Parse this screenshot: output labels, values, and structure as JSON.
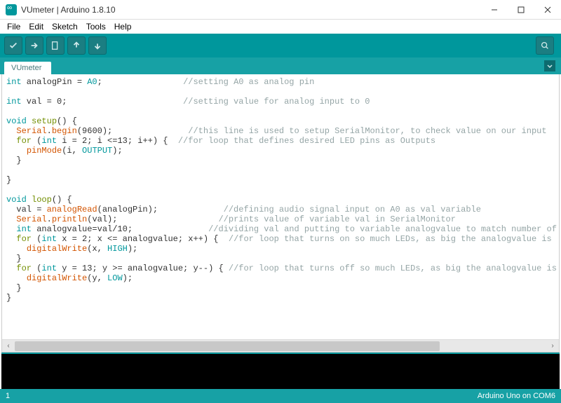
{
  "window": {
    "title": "VUmeter | Arduino 1.8.10"
  },
  "menu": {
    "file": "File",
    "edit": "Edit",
    "sketch": "Sketch",
    "tools": "Tools",
    "help": "Help"
  },
  "tab": {
    "name": "VUmeter"
  },
  "status": {
    "line": "1",
    "board": "Arduino Uno on COM6"
  },
  "code": {
    "l1_a": "int",
    "l1_b": " analogPin = ",
    "l1_c": "A0",
    "l1_d": ";                ",
    "l1_e": "//setting A0 as analog pin",
    "l2": "",
    "l3_a": "int",
    "l3_b": " val = 0;                       ",
    "l3_e": "//setting value for analog input to 0",
    "l4": "",
    "l5_a": "void",
    "l5_b": " ",
    "l5_c": "setup",
    "l5_d": "() {",
    "l6_a": "  ",
    "l6_b": "Serial",
    "l6_c": ".",
    "l6_d": "begin",
    "l6_e": "(9600);               ",
    "l6_f": "//this line is used to setup SerialMonitor, to check value on our input",
    "l7_a": "  ",
    "l7_b": "for",
    "l7_c": " (",
    "l7_d": "int",
    "l7_e": " i = 2; i <=13; i++) {  ",
    "l7_f": "//for loop that defines desired LED pins as Outputs",
    "l8_a": "    ",
    "l8_b": "pinMode",
    "l8_c": "(i, ",
    "l8_d": "OUTPUT",
    "l8_e": ");",
    "l9": "  }",
    "l10": "",
    "l11": "}",
    "l12": "",
    "l13_a": "void",
    "l13_b": " ",
    "l13_c": "loop",
    "l13_d": "() {",
    "l14_a": "  val = ",
    "l14_b": "analogRead",
    "l14_c": "(analogPin);             ",
    "l14_d": "//defining audio signal input on A0 as val variable",
    "l15_a": "  ",
    "l15_b": "Serial",
    "l15_c": ".",
    "l15_d": "println",
    "l15_e": "(val);                    ",
    "l15_f": "//prints value of variable val in SerialMonitor",
    "l16_a": "  ",
    "l16_b": "int",
    "l16_c": " analogvalue=val/10;               ",
    "l16_d": "//dividing val and putting to variable analogvalue to match number of our",
    "l17_a": "  ",
    "l17_b": "for",
    "l17_c": " (",
    "l17_d": "int",
    "l17_e": " x = 2; x <= analogvalue; x++) {  ",
    "l17_f": "//for loop that turns on so much LEDs, as big the analogvalue is",
    "l18_a": "    ",
    "l18_b": "digitalWrite",
    "l18_c": "(x, ",
    "l18_d": "HIGH",
    "l18_e": ");",
    "l19": "  }",
    "l20_a": "  ",
    "l20_b": "for",
    "l20_c": " (",
    "l20_d": "int",
    "l20_e": " y = 13; y >= analogvalue; y--) { ",
    "l20_f": "//for loop that turns off so much LEDs, as big the analogvalue is",
    "l21_a": "    ",
    "l21_b": "digitalWrite",
    "l21_c": "(y, ",
    "l21_d": "LOW",
    "l21_e": ");",
    "l22": "  }",
    "l23": "}"
  }
}
